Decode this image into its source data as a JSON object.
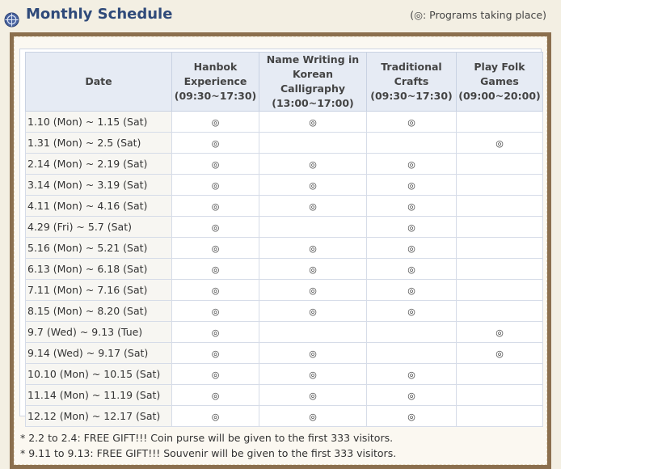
{
  "header": {
    "title": "Monthly Schedule",
    "legend": "(◎: Programs taking place)",
    "icon": "globe-icon"
  },
  "table": {
    "columns": [
      {
        "lines": [
          "Date"
        ]
      },
      {
        "lines": [
          "Hanbok",
          "Experience",
          "(09:30~17:30)"
        ]
      },
      {
        "lines": [
          "Name Writing in",
          "Korean Calligraphy",
          "(13:00~17:00)"
        ]
      },
      {
        "lines": [
          "Traditional",
          "Crafts",
          "(09:30~17:30)"
        ]
      },
      {
        "lines": [
          "Play Folk",
          "Games",
          "(09:00~20:00)"
        ]
      }
    ],
    "mark_symbol": "◎",
    "rows": [
      {
        "date": "1.10 (Mon) ~ 1.15 (Sat)",
        "marks": [
          "◎",
          "◎",
          "◎",
          ""
        ]
      },
      {
        "date": "1.31 (Mon) ~ 2.5 (Sat)",
        "marks": [
          "◎",
          "",
          "",
          "◎"
        ]
      },
      {
        "date": "2.14 (Mon) ~ 2.19 (Sat)",
        "marks": [
          "◎",
          "◎",
          "◎",
          ""
        ]
      },
      {
        "date": "3.14 (Mon) ~ 3.19 (Sat)",
        "marks": [
          "◎",
          "◎",
          "◎",
          ""
        ]
      },
      {
        "date": "4.11 (Mon) ~ 4.16 (Sat)",
        "marks": [
          "◎",
          "◎",
          "◎",
          ""
        ]
      },
      {
        "date": "4.29 (Fri) ~ 5.7 (Sat)",
        "marks": [
          "◎",
          "",
          "◎",
          ""
        ]
      },
      {
        "date": "5.16 (Mon) ~ 5.21 (Sat)",
        "marks": [
          "◎",
          "◎",
          "◎",
          ""
        ]
      },
      {
        "date": "6.13 (Mon) ~ 6.18 (Sat)",
        "marks": [
          "◎",
          "◎",
          "◎",
          ""
        ]
      },
      {
        "date": "7.11 (Mon) ~ 7.16 (Sat)",
        "marks": [
          "◎",
          "◎",
          "◎",
          ""
        ]
      },
      {
        "date": "8.15 (Mon) ~ 8.20 (Sat)",
        "marks": [
          "◎",
          "◎",
          "◎",
          ""
        ]
      },
      {
        "date": "9.7 (Wed) ~ 9.13 (Tue)",
        "marks": [
          "◎",
          "",
          "",
          "◎"
        ]
      },
      {
        "date": "9.14 (Wed) ~ 9.17 (Sat)",
        "marks": [
          "◎",
          "◎",
          "",
          "◎"
        ]
      },
      {
        "date": "10.10 (Mon) ~ 10.15 (Sat)",
        "marks": [
          "◎",
          "◎",
          "◎",
          ""
        ]
      },
      {
        "date": "11.14 (Mon) ~ 11.19 (Sat)",
        "marks": [
          "◎",
          "◎",
          "◎",
          ""
        ]
      },
      {
        "date": "12.12 (Mon) ~ 12.17 (Sat)",
        "marks": [
          "◎",
          "◎",
          "◎",
          ""
        ]
      }
    ]
  },
  "notes": [
    "* 2.2 to 2.4: FREE GIFT!!! Coin purse will be given to the first 333 visitors.",
    "* 9.11 to 9.13: FREE GIFT!!! Souvenir will be given to the first 333 visitors."
  ],
  "colors": {
    "title": "#2f4a7a",
    "frame": "#8b6f4e",
    "header_bg": "#e6ebf4",
    "panel_bg": "#f3efe3"
  }
}
